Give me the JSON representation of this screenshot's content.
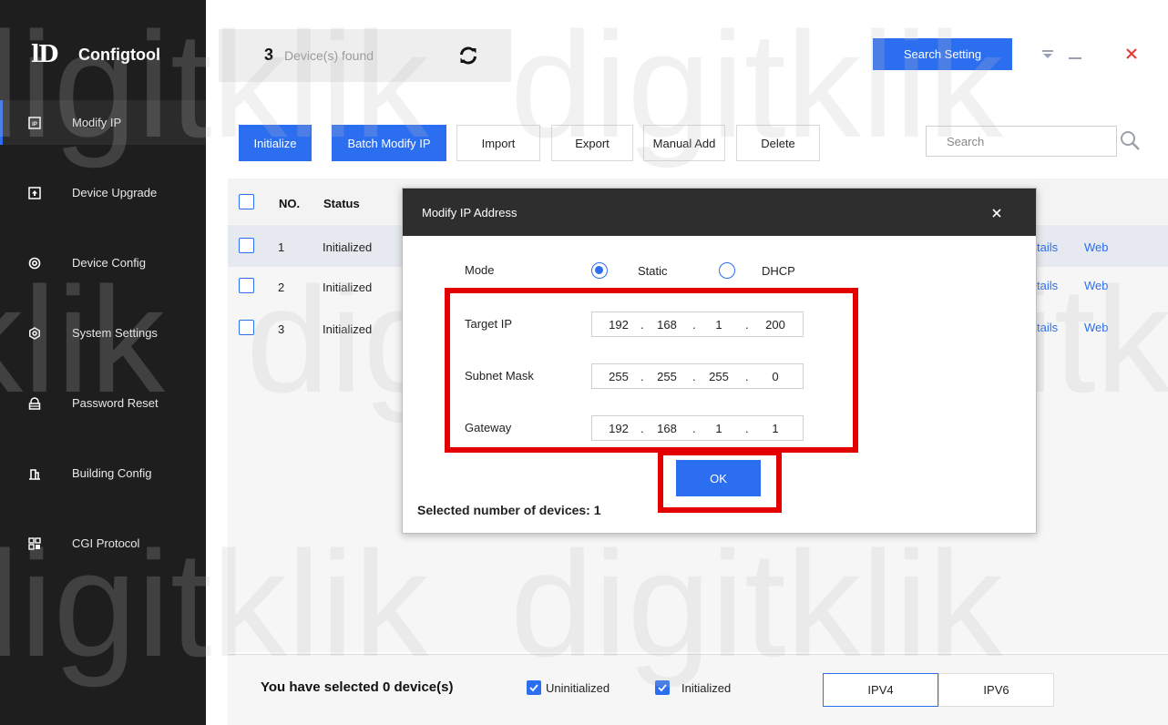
{
  "app": {
    "logo_mark": "lD",
    "name": "Configtool"
  },
  "sidebar": {
    "items": [
      {
        "label": "Modify IP",
        "icon": "ip-icon",
        "active": true
      },
      {
        "label": "Device Upgrade",
        "icon": "upgrade-icon",
        "active": false
      },
      {
        "label": "Device Config",
        "icon": "config-icon",
        "active": false
      },
      {
        "label": "System Settings",
        "icon": "settings-icon",
        "active": false
      },
      {
        "label": "Password Reset",
        "icon": "lock-icon",
        "active": false
      },
      {
        "label": "Building Config",
        "icon": "building-icon",
        "active": false
      },
      {
        "label": "CGI Protocol",
        "icon": "cgi-icon",
        "active": false
      }
    ]
  },
  "topbar": {
    "device_count": "3",
    "device_found_label": "Device(s) found",
    "search_setting_label": "Search Setting"
  },
  "toolbar": {
    "initialize": "Initialize",
    "batch_modify_ip": "Batch Modify IP",
    "import": "Import",
    "export": "Export",
    "manual_add": "Manual Add",
    "delete": "Delete",
    "search_placeholder": "Search"
  },
  "table": {
    "headers": {
      "no": "NO.",
      "status": "Status"
    },
    "rows": [
      {
        "no": "1",
        "status": "Initialized",
        "details": "tails",
        "web": "Web"
      },
      {
        "no": "2",
        "status": "Initialized",
        "details": "tails",
        "web": "Web"
      },
      {
        "no": "3",
        "status": "Initialized",
        "details": "tails",
        "web": "Web"
      }
    ]
  },
  "footer": {
    "selected_text": "You have selected 0  device(s)",
    "uninitialized_label": "Uninitialized",
    "initialized_label": "Initialized",
    "ipv4_label": "IPV4",
    "ipv6_label": "IPV6"
  },
  "modal": {
    "title": "Modify IP Address",
    "close": "×",
    "mode_label": "Mode",
    "static_label": "Static",
    "dhcp_label": "DHCP",
    "mode_selected": "Static",
    "target_ip_label": "Target IP",
    "target_ip": [
      "192",
      "168",
      "1",
      "200"
    ],
    "subnet_mask_label": "Subnet Mask",
    "subnet_mask": [
      "255",
      "255",
      "255",
      "0"
    ],
    "gateway_label": "Gateway",
    "gateway": [
      "192",
      "168",
      "1",
      "1"
    ],
    "ip_separator": ".",
    "ok_label": "OK",
    "selected_devices": "Selected number of devices: 1"
  },
  "watermark": {
    "text": "digitklik"
  },
  "colors": {
    "accent": "#2c6ef0",
    "sidebar_bg": "#1e1e1e",
    "highlight": "#e50000",
    "close_red": "#e53935"
  }
}
